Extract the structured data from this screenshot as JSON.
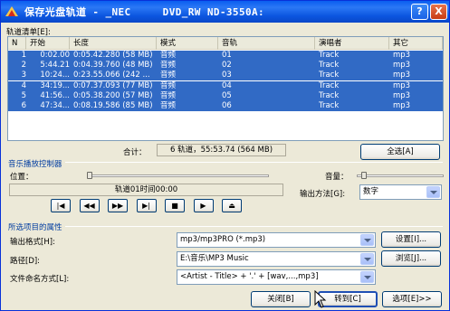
{
  "window": {
    "title": "保存光盘轨道 - _NEC     DVD_RW ND-3550A:",
    "help_label": "?",
    "close_label": "X"
  },
  "tracklist": {
    "label": "轨道清单[E]:",
    "columns": [
      "N",
      "开始",
      "长度",
      "模式",
      "音轨",
      "演唱者",
      "其它"
    ],
    "rows": [
      [
        "1",
        "0:02.00",
        "0:05.42.280 (58 MB)",
        "音频",
        "01",
        "Track",
        "mp3"
      ],
      [
        "2",
        "5:44.21",
        "0:04.39.760 (48 MB)",
        "音频",
        "02",
        "Track",
        "mp3"
      ],
      [
        "3",
        "10:24...",
        "0:23.55.066 (242 ...",
        "音频",
        "03",
        "Track",
        "mp3"
      ],
      [
        "4",
        "34:19...",
        "0:07.37.093 (77 MB)",
        "音频",
        "04",
        "Track",
        "mp3"
      ],
      [
        "5",
        "41:56...",
        "0:05.38.200 (57 MB)",
        "音频",
        "05",
        "Track",
        "mp3"
      ],
      [
        "6",
        "47:34...",
        "0:08.19.586 (85 MB)",
        "音频",
        "06",
        "Track",
        "mp3"
      ]
    ],
    "total_label": "合计：",
    "total_value": "6 轨道，55:53.74 (564 MB)",
    "select_all_label": "全选[A]"
  },
  "player": {
    "group_title": "音乐播放控制器",
    "position_label": "位置：",
    "volume_label": "音量：",
    "status_text": "轨道01时间00:00",
    "output_method_label": "输出方法[G]:",
    "output_method_value": "数字",
    "controls": [
      {
        "name": "first-track-icon",
        "glyph": "|◀"
      },
      {
        "name": "rewind-icon",
        "glyph": "◀◀"
      },
      {
        "name": "fast-forward-icon",
        "glyph": "▶▶"
      },
      {
        "name": "last-track-icon",
        "glyph": "▶|"
      },
      {
        "name": "stop-icon",
        "glyph": "■"
      },
      {
        "name": "play-icon",
        "glyph": "▶"
      },
      {
        "name": "eject-icon",
        "glyph": "⏏"
      }
    ]
  },
  "properties": {
    "group_title": "所选项目的属性",
    "format_label": "输出格式[H]:",
    "format_value": "mp3/mp3PRO (*.mp3)",
    "settings_label": "设置[I]...",
    "path_label": "路径[D]:",
    "path_value": "E:\\音乐\\MP3 Music",
    "browse_label": "浏览[J]...",
    "naming_label": "文件命名方式[L]:",
    "naming_value": "<Artist - Title> + '.' + [wav,...,mp3]"
  },
  "footer": {
    "close_label": "关闭[B]",
    "goto_label": "转到[C]",
    "options_label": "选项[E]>>"
  }
}
